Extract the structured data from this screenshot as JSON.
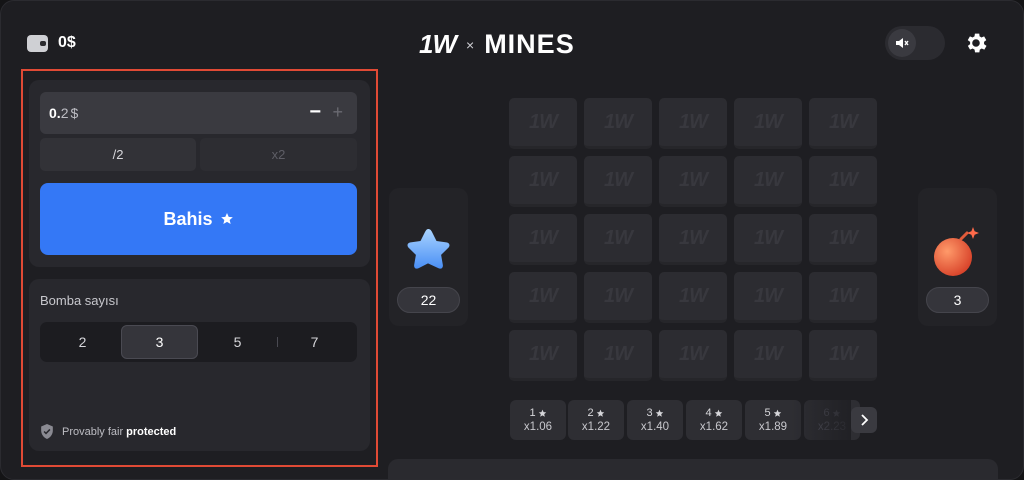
{
  "header": {
    "balance": "0$",
    "brand_logo": "1W",
    "brand_sep": "×",
    "brand_title": "MINES",
    "sound_icon": "speaker-muted-icon",
    "settings_icon": "gear-icon"
  },
  "bet": {
    "amount_value": "0.",
    "amount_decimal": "2",
    "currency": "$",
    "minus": "−",
    "plus": "+",
    "half_label": "/2",
    "double_label": "x2",
    "bet_label": "Bahis"
  },
  "bombs": {
    "label": "Bomba sayısı",
    "options": [
      "2",
      "3",
      "5",
      "7"
    ],
    "selected": "3"
  },
  "fair": {
    "text": "Provably fair",
    "strong": "protected"
  },
  "side": {
    "gems": "22",
    "bombs": "3"
  },
  "tile_logo": "1W",
  "multipliers": [
    {
      "step": "1",
      "value": "x1.06"
    },
    {
      "step": "2",
      "value": "x1.22"
    },
    {
      "step": "3",
      "value": "x1.40"
    },
    {
      "step": "4",
      "value": "x1.62"
    },
    {
      "step": "5",
      "value": "x1.89"
    },
    {
      "step": "6",
      "value": "x2.23"
    }
  ],
  "colors": {
    "accent": "#3478f6",
    "highlight_border": "#e04a35",
    "background": "#1e1e22"
  }
}
